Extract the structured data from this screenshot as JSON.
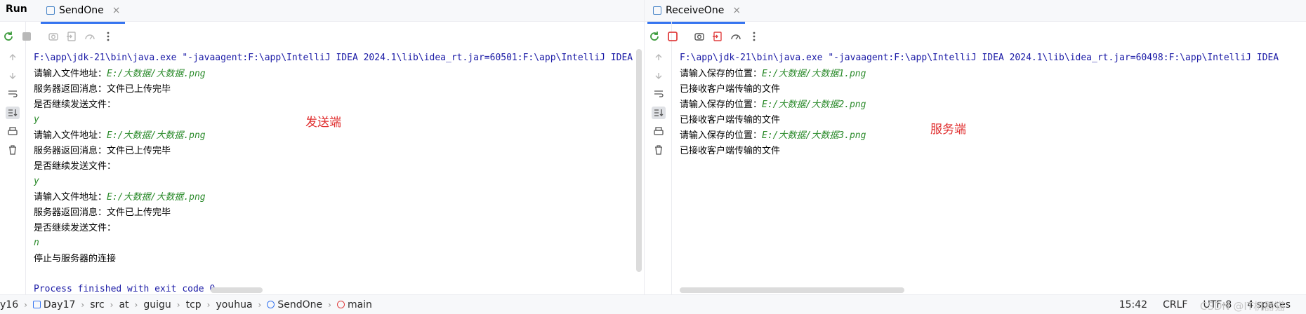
{
  "topbar": {
    "run_label": "Run",
    "tabs": [
      {
        "label": "SendOne",
        "close": "×"
      },
      {
        "label": "ReceiveOne",
        "close": "×"
      }
    ]
  },
  "left_console": {
    "lines": [
      {
        "type": "cmd",
        "text": "F:\\app\\jdk-21\\bin\\java.exe \"-javaagent:F:\\app\\IntelliJ IDEA 2024.1\\lib\\idea_rt.jar=60501:F:\\app\\IntelliJ IDEA"
      },
      {
        "type": "mixed",
        "prefix": "请输入文件地址：",
        "input": "E:/大数据/大数据.png"
      },
      {
        "type": "out",
        "text": "服务器返回消息：文件已上传完毕"
      },
      {
        "type": "out",
        "text": "是否继续发送文件："
      },
      {
        "type": "in",
        "text": "y"
      },
      {
        "type": "mixed",
        "prefix": "请输入文件地址：",
        "input": "E:/大数据/大数据.png"
      },
      {
        "type": "out",
        "text": "服务器返回消息：文件已上传完毕"
      },
      {
        "type": "out",
        "text": "是否继续发送文件："
      },
      {
        "type": "in",
        "text": "y"
      },
      {
        "type": "mixed",
        "prefix": "请输入文件地址：",
        "input": "E:/大数据/大数据.png"
      },
      {
        "type": "out",
        "text": "服务器返回消息：文件已上传完毕"
      },
      {
        "type": "out",
        "text": "是否继续发送文件："
      },
      {
        "type": "in",
        "text": "n"
      },
      {
        "type": "out",
        "text": "停止与服务器的连接"
      },
      {
        "type": "out",
        "text": ""
      },
      {
        "type": "fin",
        "text": "Process finished with exit code 0"
      }
    ],
    "annotation": "发送端"
  },
  "right_console": {
    "lines": [
      {
        "type": "cmd",
        "text": "F:\\app\\jdk-21\\bin\\java.exe \"-javaagent:F:\\app\\IntelliJ IDEA 2024.1\\lib\\idea_rt.jar=60498:F:\\app\\IntelliJ IDEA"
      },
      {
        "type": "mixed",
        "prefix": "请输入保存的位置：",
        "input": "E:/大数据/大数据1.png"
      },
      {
        "type": "out",
        "text": "已接收客户端传输的文件"
      },
      {
        "type": "mixed",
        "prefix": "请输入保存的位置：",
        "input": "E:/大数据/大数据2.png"
      },
      {
        "type": "out",
        "text": "已接收客户端传输的文件"
      },
      {
        "type": "mixed",
        "prefix": "请输入保存的位置：",
        "input": "E:/大数据/大数据3.png"
      },
      {
        "type": "out",
        "text": "已接收客户端传输的文件"
      }
    ],
    "annotation": "服务端"
  },
  "statusbar": {
    "crumbs": [
      "y16",
      "Day17",
      "src",
      "at",
      "guigu",
      "tcp",
      "youhua",
      "SendOne",
      "main"
    ],
    "position": "15:42",
    "line_sep": "CRLF",
    "encoding": "UTF-8",
    "indent": "4 spaces"
  },
  "watermark": "CSDN @IT机器猫",
  "colors": {
    "accent": "#3574f0",
    "cmd_text": "#1a1aa6",
    "input_text": "#2a8a2a",
    "annotation": "#e03030",
    "stop_red": "#e04040",
    "rerun_green": "#3a9a3a"
  }
}
